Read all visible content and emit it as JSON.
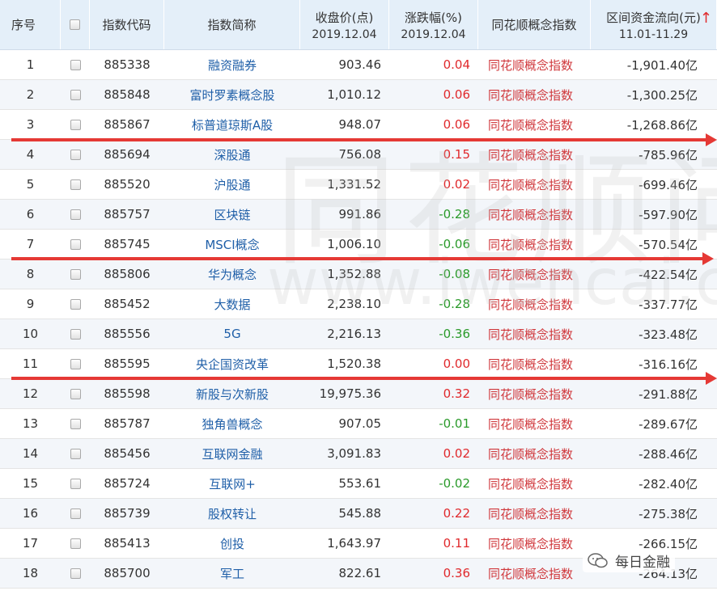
{
  "header": {
    "seq": "序号",
    "code": "指数代码",
    "name": "指数简称",
    "close_line1": "收盘价(点)",
    "close_line2": "2019.12.04",
    "chg_line1": "涨跌幅(%)",
    "chg_line2": "2019.12.04",
    "concept": "同花顺概念指数",
    "flow_line1": "区间资金流向(元)",
    "flow_line2": "11.01-11.29",
    "sort_icon": "↑"
  },
  "rows": [
    {
      "seq": "1",
      "code": "885338",
      "name": "融资融券",
      "close": "903.46",
      "chg": "0.04",
      "dir": "up",
      "concept": "同花顺概念指数",
      "flow": "-1,901.40亿"
    },
    {
      "seq": "2",
      "code": "885848",
      "name": "富时罗素概念股",
      "close": "1,010.12",
      "chg": "0.06",
      "dir": "up",
      "concept": "同花顺概念指数",
      "flow": "-1,300.25亿"
    },
    {
      "seq": "3",
      "code": "885867",
      "name": "标普道琼斯A股",
      "close": "948.07",
      "chg": "0.06",
      "dir": "up",
      "concept": "同花顺概念指数",
      "flow": "-1,268.86亿"
    },
    {
      "seq": "4",
      "code": "885694",
      "name": "深股通",
      "close": "756.08",
      "chg": "0.15",
      "dir": "up",
      "concept": "同花顺概念指数",
      "flow": "-785.96亿"
    },
    {
      "seq": "5",
      "code": "885520",
      "name": "沪股通",
      "close": "1,331.52",
      "chg": "0.02",
      "dir": "up",
      "concept": "同花顺概念指数",
      "flow": "-699.46亿"
    },
    {
      "seq": "6",
      "code": "885757",
      "name": "区块链",
      "close": "991.86",
      "chg": "-0.28",
      "dir": "down",
      "concept": "同花顺概念指数",
      "flow": "-597.90亿"
    },
    {
      "seq": "7",
      "code": "885745",
      "name": "MSCI概念",
      "close": "1,006.10",
      "chg": "-0.06",
      "dir": "down",
      "concept": "同花顺概念指数",
      "flow": "-570.54亿"
    },
    {
      "seq": "8",
      "code": "885806",
      "name": "华为概念",
      "close": "1,352.88",
      "chg": "-0.08",
      "dir": "down",
      "concept": "同花顺概念指数",
      "flow": "-422.54亿"
    },
    {
      "seq": "9",
      "code": "885452",
      "name": "大数据",
      "close": "2,238.10",
      "chg": "-0.28",
      "dir": "down",
      "concept": "同花顺概念指数",
      "flow": "-337.77亿"
    },
    {
      "seq": "10",
      "code": "885556",
      "name": "5G",
      "close": "2,216.13",
      "chg": "-0.36",
      "dir": "down",
      "concept": "同花顺概念指数",
      "flow": "-323.48亿"
    },
    {
      "seq": "11",
      "code": "885595",
      "name": "央企国资改革",
      "close": "1,520.38",
      "chg": "0.00",
      "dir": "flat",
      "concept": "同花顺概念指数",
      "flow": "-316.16亿"
    },
    {
      "seq": "12",
      "code": "885598",
      "name": "新股与次新股",
      "close": "19,975.36",
      "chg": "0.32",
      "dir": "up",
      "concept": "同花顺概念指数",
      "flow": "-291.88亿"
    },
    {
      "seq": "13",
      "code": "885787",
      "name": "独角兽概念",
      "close": "907.05",
      "chg": "-0.01",
      "dir": "down",
      "concept": "同花顺概念指数",
      "flow": "-289.67亿"
    },
    {
      "seq": "14",
      "code": "885456",
      "name": "互联网金融",
      "close": "3,091.83",
      "chg": "0.02",
      "dir": "up",
      "concept": "同花顺概念指数",
      "flow": "-288.46亿"
    },
    {
      "seq": "15",
      "code": "885724",
      "name": "互联网+",
      "close": "553.61",
      "chg": "-0.02",
      "dir": "down",
      "concept": "同花顺概念指数",
      "flow": "-282.40亿"
    },
    {
      "seq": "16",
      "code": "885739",
      "name": "股权转让",
      "close": "545.88",
      "chg": "0.22",
      "dir": "up",
      "concept": "同花顺概念指数",
      "flow": "-275.38亿"
    },
    {
      "seq": "17",
      "code": "885413",
      "name": "创投",
      "close": "1,643.97",
      "chg": "0.11",
      "dir": "up",
      "concept": "同花顺概念指数",
      "flow": "-266.15亿"
    },
    {
      "seq": "18",
      "code": "885700",
      "name": "军工",
      "close": "822.61",
      "chg": "0.36",
      "dir": "up",
      "concept": "同花顺概念指数",
      "flow": "-264.13亿"
    }
  ],
  "watermark": {
    "big": "同花顺问",
    "url": "www.iwencai.c"
  },
  "wechat": {
    "label": "每日金融",
    "icon": "wechat-icon"
  },
  "colors": {
    "up": "#e0292c",
    "down": "#2a9a2a",
    "link": "#1f5fa8",
    "concept": "#d0383c",
    "header_bg": "#e4eff9",
    "annotation": "#e53935"
  }
}
